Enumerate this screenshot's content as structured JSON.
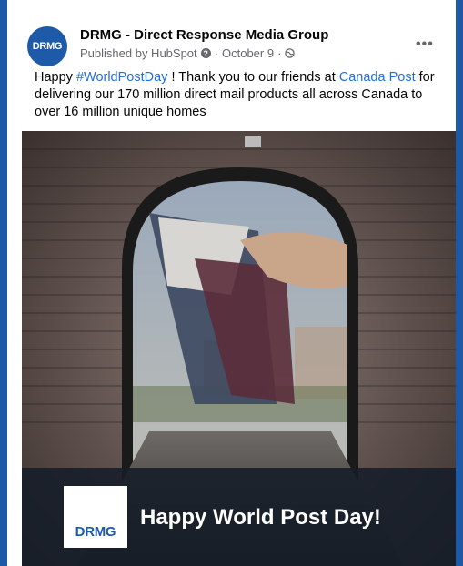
{
  "post": {
    "avatar_text": "DRMG",
    "page_name": "DRMG - Direct Response Media Group",
    "published_by": "Published by HubSpot",
    "date": "October 9",
    "more_label": "•••",
    "text_before_tag": "Happy ",
    "hashtag": "#WorldPostDay",
    "text_middle": " ! Thank you to our friends at ",
    "mention": "Canada Post",
    "text_after": " for delivering our 170 million direct mail products all across Canada to over 16 million unique homes"
  },
  "image": {
    "banner_text": "Happy World Post Day!",
    "logo_text": "DRMG"
  }
}
